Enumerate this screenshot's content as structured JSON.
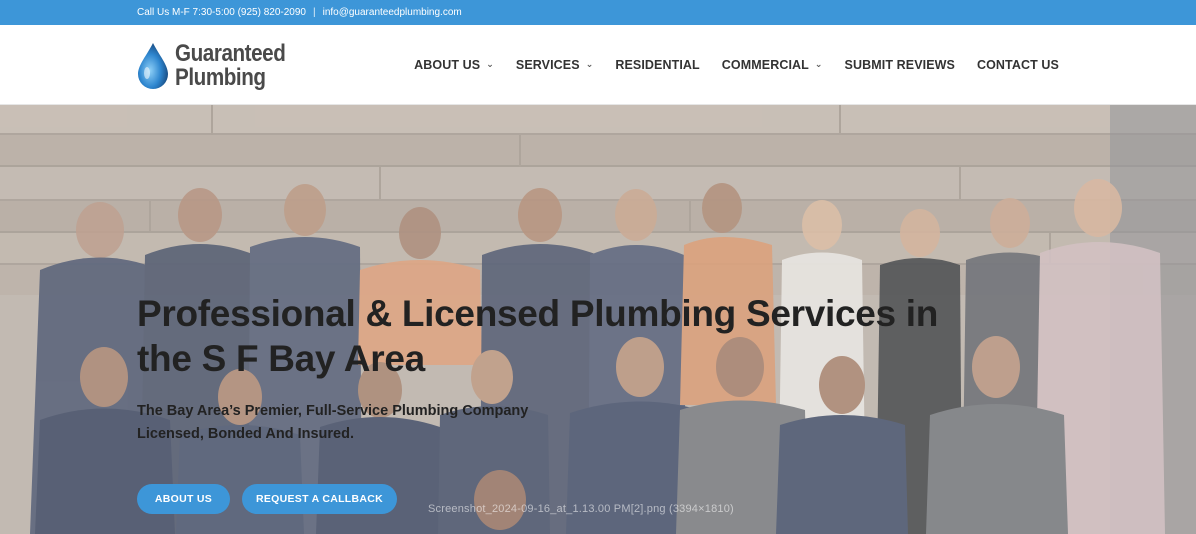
{
  "topbar": {
    "phone_text": "Call Us M-F 7:30-5:00 (925) 820-2090",
    "separator": "|",
    "email": "info@guaranteedplumbing.com"
  },
  "logo": {
    "line1": "Guaranteed",
    "line2": "Plumbing",
    "icon": "water-drop-icon"
  },
  "nav": {
    "items": [
      {
        "label": "ABOUT US",
        "has_dropdown": true
      },
      {
        "label": "SERVICES",
        "has_dropdown": true
      },
      {
        "label": "RESIDENTIAL",
        "has_dropdown": false
      },
      {
        "label": "COMMERCIAL",
        "has_dropdown": true
      },
      {
        "label": "SUBMIT REVIEWS",
        "has_dropdown": false
      },
      {
        "label": "CONTACT US",
        "has_dropdown": false
      }
    ],
    "chevron": "⌄"
  },
  "hero": {
    "title_line1": "Professional & Licensed Plumbing Services in",
    "title_line2": "the S F Bay Area",
    "subtitle_line1": "The Bay Area’s Premier, Full-Service Plumbing Company",
    "subtitle_line2": "Licensed, Bonded And Insured.",
    "buttons": {
      "about": "ABOUT US",
      "callback": "REQUEST A CALLBACK"
    },
    "watermark": "Screenshot_2024-09-16_at_1.13.00 PM[2].png (3394×1810)"
  },
  "colors": {
    "accent": "#3d96d8",
    "text_dark": "#222222",
    "nav_text": "#333333"
  }
}
